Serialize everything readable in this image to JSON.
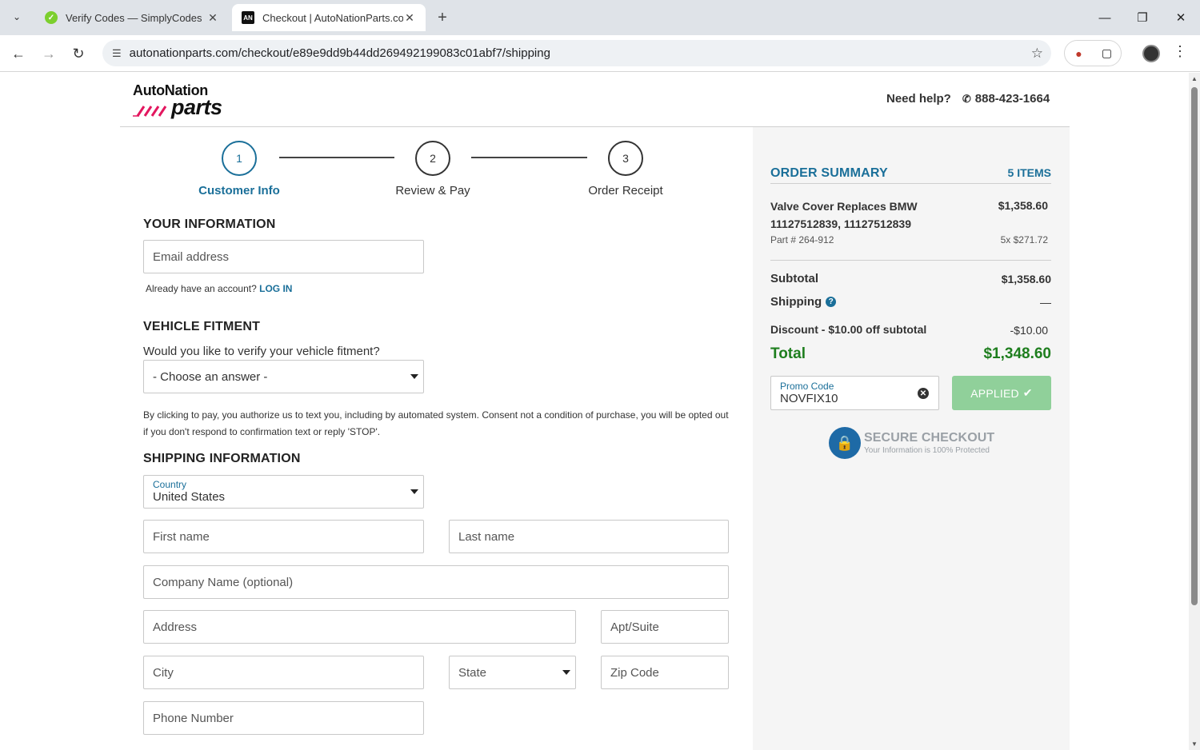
{
  "browser": {
    "tabs": [
      {
        "title": "Verify Codes — SimplyCodes",
        "active": false
      },
      {
        "title": "Checkout | AutoNationParts.com",
        "active": true
      }
    ],
    "url": "autonationparts.com/checkout/e89e9dd9b44dd269492199083c01abf7/shipping"
  },
  "header": {
    "logo_line1": "AutoNation",
    "logo_line2": "parts",
    "help_label": "Need help?",
    "phone": "888-423-1664"
  },
  "stepper": [
    {
      "number": "1",
      "label": "Customer Info",
      "current": true
    },
    {
      "number": "2",
      "label": "Review & Pay",
      "current": false
    },
    {
      "number": "3",
      "label": "Order Receipt",
      "current": false
    }
  ],
  "your_info": {
    "heading": "YOUR INFORMATION",
    "email_placeholder": "Email address",
    "account_prompt": "Already have an account?",
    "login_link": "LOG IN"
  },
  "vehicle": {
    "heading": "VEHICLE FITMENT",
    "question": "Would you like to verify your vehicle fitment?",
    "select_value": "- Choose an answer -",
    "consent": "By clicking to pay, you authorize us to text you, including by automated system. Consent not a condition of purchase, you will be opted out if you don't respond to confirmation text or reply 'STOP'."
  },
  "shipping": {
    "heading": "SHIPPING INFORMATION",
    "country_label": "Country",
    "country_value": "United States",
    "first_name": "First name",
    "last_name": "Last name",
    "company": "Company Name (optional)",
    "address": "Address",
    "apt": "Apt/Suite",
    "city": "City",
    "state": "State",
    "zip": "Zip Code",
    "phone": "Phone Number"
  },
  "summary": {
    "title": "ORDER SUMMARY",
    "item_count": "5 ITEMS",
    "item_name": "Valve Cover Replaces BMW 11127512839, 11127512839",
    "item_price": "$1,358.60",
    "item_part": "Part # 264-912",
    "item_qty": "5x $271.72",
    "subtotal_label": "Subtotal",
    "subtotal_value": "$1,358.60",
    "shipping_label": "Shipping",
    "shipping_value": "—",
    "discount_label": "Discount - $10.00 off subtotal",
    "discount_value": "-$10.00",
    "total_label": "Total",
    "total_value": "$1,348.60",
    "promo_label": "Promo Code",
    "promo_value": "NOVFIX10",
    "applied_label": "APPLIED",
    "secure_title": "SECURE CHECKOUT",
    "secure_sub": "Your Information is 100% Protected"
  },
  "colors": {
    "accent": "#1a6f99",
    "total_green": "#1e7e1e",
    "applied_button": "#90d09a",
    "logo_slashes": "#e3175f"
  }
}
